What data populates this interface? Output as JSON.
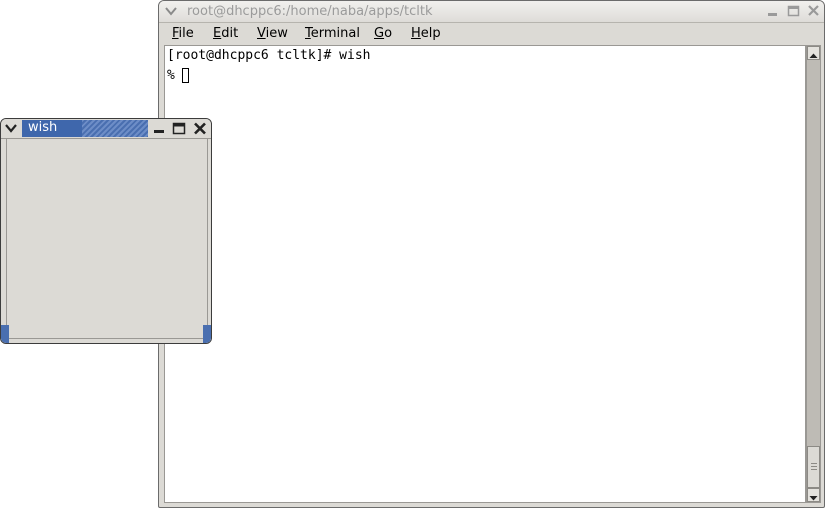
{
  "terminal": {
    "title": "root@dhcppc6:/home/naba/apps/tcltk",
    "menu": [
      {
        "label": "File",
        "mnemonic": "F",
        "rest": "ile"
      },
      {
        "label": "Edit",
        "mnemonic": "E",
        "rest": "dit"
      },
      {
        "label": "View",
        "mnemonic": "V",
        "rest": "iew"
      },
      {
        "label": "Terminal",
        "mnemonic": "T",
        "rest": "erminal"
      },
      {
        "label": "Go",
        "mnemonic": "G",
        "rest": "o"
      },
      {
        "label": "Help",
        "mnemonic": "H",
        "rest": "elp"
      }
    ],
    "lines": [
      "[root@dhcppc6 tcltk]# wish",
      "%"
    ],
    "icons": {
      "menu": "chevron-down-icon",
      "minimize": "minimize-icon",
      "maximize": "maximize-icon",
      "close": "close-icon"
    }
  },
  "wish": {
    "title": "wish",
    "colors": {
      "title_active": "#3f67ac",
      "title_stripe": "#6d8dc7"
    }
  }
}
